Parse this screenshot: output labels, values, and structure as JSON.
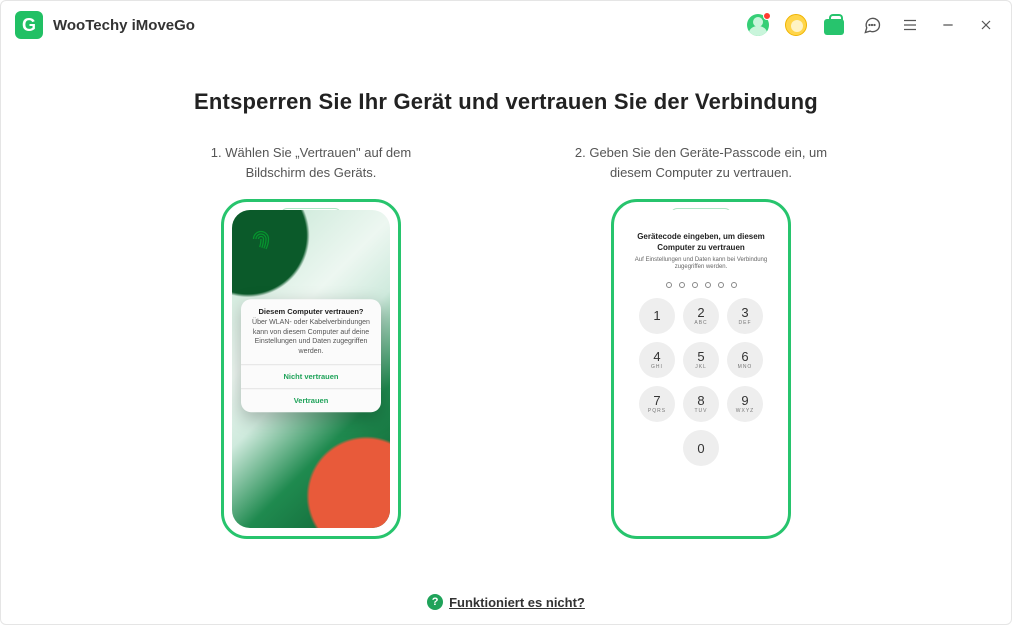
{
  "app": {
    "title": "WooTechy iMoveGo",
    "logo_letter": "G"
  },
  "titlebar_icons": {
    "user": "user-icon",
    "coin": "coin-icon",
    "bag": "shopping-bag-icon",
    "feedback": "chat-bubble-icon",
    "menu": "menu-icon",
    "minimize": "minimize-icon",
    "close": "close-icon"
  },
  "page": {
    "title": "Entsperren Sie Ihr Gerät und vertrauen Sie der Verbindung",
    "step1_text": "1. Wählen Sie „Vertrauen\" auf dem Bildschirm des Geräts.",
    "step2_text": "2. Geben Sie den Geräte-Passcode ein, um diesem Computer zu vertrauen.",
    "help_link": "Funktioniert es nicht?"
  },
  "phone1": {
    "alert": {
      "title": "Diesem Computer vertrauen?",
      "body": "Über WLAN- oder Kabelverbindungen kann von diesem Computer auf deine Einstellungen und Daten zugegriffen werden.",
      "button_deny": "Nicht vertrauen",
      "button_allow": "Vertrauen"
    }
  },
  "phone2": {
    "title": "Gerätecode eingeben, um diesem Computer zu vertrauen",
    "subtitle": "Auf Einstellungen und Daten kann bei Verbindung zugegriffen werden.",
    "keys": [
      {
        "num": "1",
        "let": ""
      },
      {
        "num": "2",
        "let": "ABC"
      },
      {
        "num": "3",
        "let": "DEF"
      },
      {
        "num": "4",
        "let": "GHI"
      },
      {
        "num": "5",
        "let": "JKL"
      },
      {
        "num": "6",
        "let": "MNO"
      },
      {
        "num": "7",
        "let": "PQRS"
      },
      {
        "num": "8",
        "let": "TUV"
      },
      {
        "num": "9",
        "let": "WXYZ"
      },
      {
        "num": "0",
        "let": ""
      }
    ]
  }
}
